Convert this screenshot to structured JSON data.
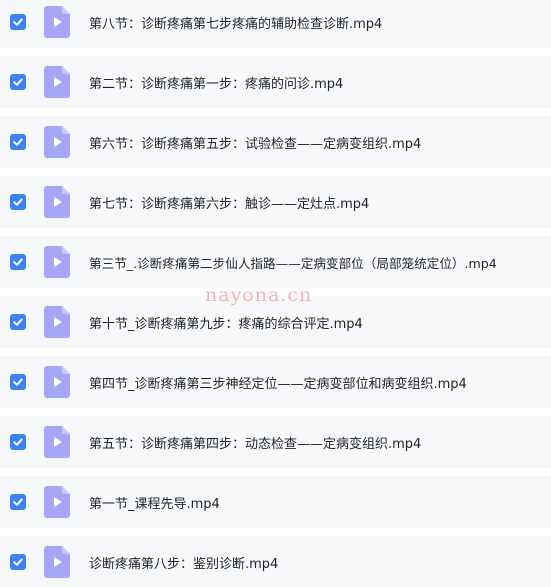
{
  "files": [
    {
      "name": "第八节：诊断疼痛第七步疼痛的辅助检查诊断.mp4",
      "checked": true
    },
    {
      "name": "第二节：诊断疼痛第一步：疼痛的问诊.mp4",
      "checked": true
    },
    {
      "name": "第六节：诊断疼痛第五步：试验检查——定病变组织.mp4",
      "checked": true
    },
    {
      "name": "第七节：诊断疼痛第六步：触诊——定灶点.mp4",
      "checked": true
    },
    {
      "name": "第三节_.诊断疼痛第二步仙人指路——定病变部位（局部笼统定位）.mp4",
      "checked": true
    },
    {
      "name": "第十节_诊断疼痛第九步：疼痛的综合评定.mp4",
      "checked": true
    },
    {
      "name": "第四节_诊断疼痛第三步神经定位——定病变部位和病变组织.mp4",
      "checked": true
    },
    {
      "name": "第五节：诊断疼痛第四步：动态检查——定病变组织.mp4",
      "checked": true
    },
    {
      "name": "第一节_课程先导.mp4",
      "checked": true
    },
    {
      "name": "诊断疼痛第八步：鉴别诊断.mp4",
      "checked": true
    }
  ],
  "watermark": "nayona.cn",
  "icons": {
    "checkbox": "checkbox-checked-icon",
    "file": "video-file-icon"
  },
  "colors": {
    "checkbox": "#3b82f6",
    "file_icon": "#a5a6f6",
    "row_background": "#f7f8fa",
    "watermark": "#f2b3b3"
  }
}
